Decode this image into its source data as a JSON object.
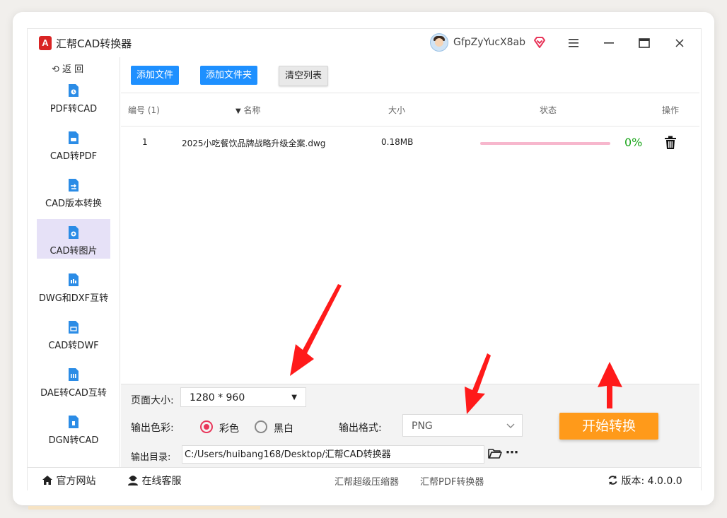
{
  "app": {
    "title": "汇帮CAD转换器",
    "logo_letter": "A",
    "username": "GfpZyYucX8ab"
  },
  "sidebar": {
    "back_label": "返 回",
    "items": [
      {
        "label": "PDF转CAD",
        "active": false
      },
      {
        "label": "CAD转PDF",
        "active": false
      },
      {
        "label": "CAD版本转换",
        "active": false
      },
      {
        "label": "CAD转图片",
        "active": true
      },
      {
        "label": "DWG和DXF互转",
        "active": false
      },
      {
        "label": "CAD转DWF",
        "active": false
      },
      {
        "label": "DAE转CAD互转",
        "active": false
      },
      {
        "label": "DGN转CAD",
        "active": false
      }
    ]
  },
  "toolbar": {
    "add_file": "添加文件",
    "add_folder": "添加文件夹",
    "clear_list": "清空列表"
  },
  "table": {
    "headers": {
      "index": "编号 (1)",
      "name": "名称",
      "size": "大小",
      "status": "状态",
      "action": "操作"
    },
    "rows": [
      {
        "index": "1",
        "name": "2025小吃餐饮品牌战略升级全案.dwg",
        "size": "0.18MB",
        "progress": 0,
        "progress_label": "0%"
      }
    ]
  },
  "settings": {
    "page_size_label": "页面大小:",
    "page_size_value": "1280 * 960",
    "color_label": "输出色彩:",
    "color_options": [
      "彩色",
      "黑白"
    ],
    "color_selected": "彩色",
    "format_label": "输出格式:",
    "format_value": "PNG",
    "output_dir_label": "输出目录:",
    "output_dir_value": "C:/Users/huibang168/Desktop/汇帮CAD转换器",
    "start_button": "开始转换"
  },
  "footer": {
    "website": "官方网站",
    "support": "在线客服",
    "link1": "汇帮超级压缩器",
    "link2": "汇帮PDF转换器",
    "version_label": "版本:",
    "version": "4.0.0.0"
  },
  "colors": {
    "accent_blue": "#1e90ff",
    "start_orange": "#ff9a1a",
    "active_nav": "#e6e1f7",
    "progress_pink": "#f7b7cd",
    "percent_green": "#1aa51a",
    "arrow_red": "#ff1a1a"
  }
}
